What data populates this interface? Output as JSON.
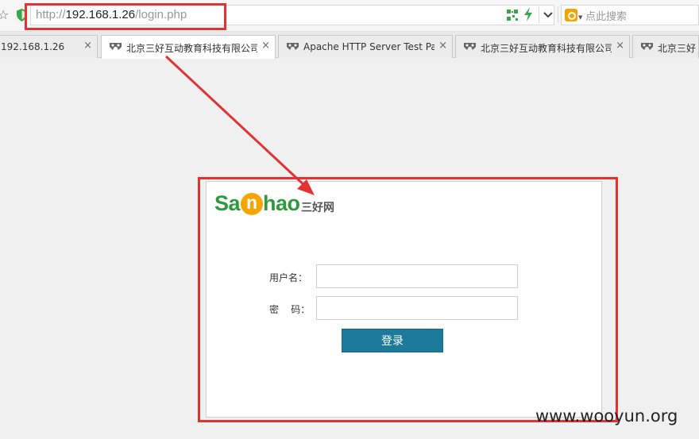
{
  "address_bar": {
    "url_scheme": "http://",
    "url_host": "192.168.1.26",
    "url_path": "/login.php",
    "search_placeholder": "点此搜索"
  },
  "tabs": [
    {
      "label": "192.168.1.26",
      "active": false
    },
    {
      "label": "北京三好互动教育科技有限公司",
      "active": true
    },
    {
      "label": "Apache HTTP Server Test Page",
      "active": false
    },
    {
      "label": "北京三好互动教育科技有限公司",
      "active": false
    },
    {
      "label": "北京三好",
      "active": false
    }
  ],
  "close_glyph": "×",
  "logo": {
    "sa": "Sa",
    "n": "n",
    "hao": "hao",
    "cn": "三好网"
  },
  "login_form": {
    "username_label": "用户名：",
    "password_label": "密    码：",
    "username_value": "",
    "password_value": "",
    "submit_label": "登录"
  },
  "watermark": "www.wooyun.org",
  "colors": {
    "annotation": "#e23333",
    "button": "#1c7a9a",
    "logo_green": "#2e9a3e",
    "logo_orange": "#f5a400"
  }
}
